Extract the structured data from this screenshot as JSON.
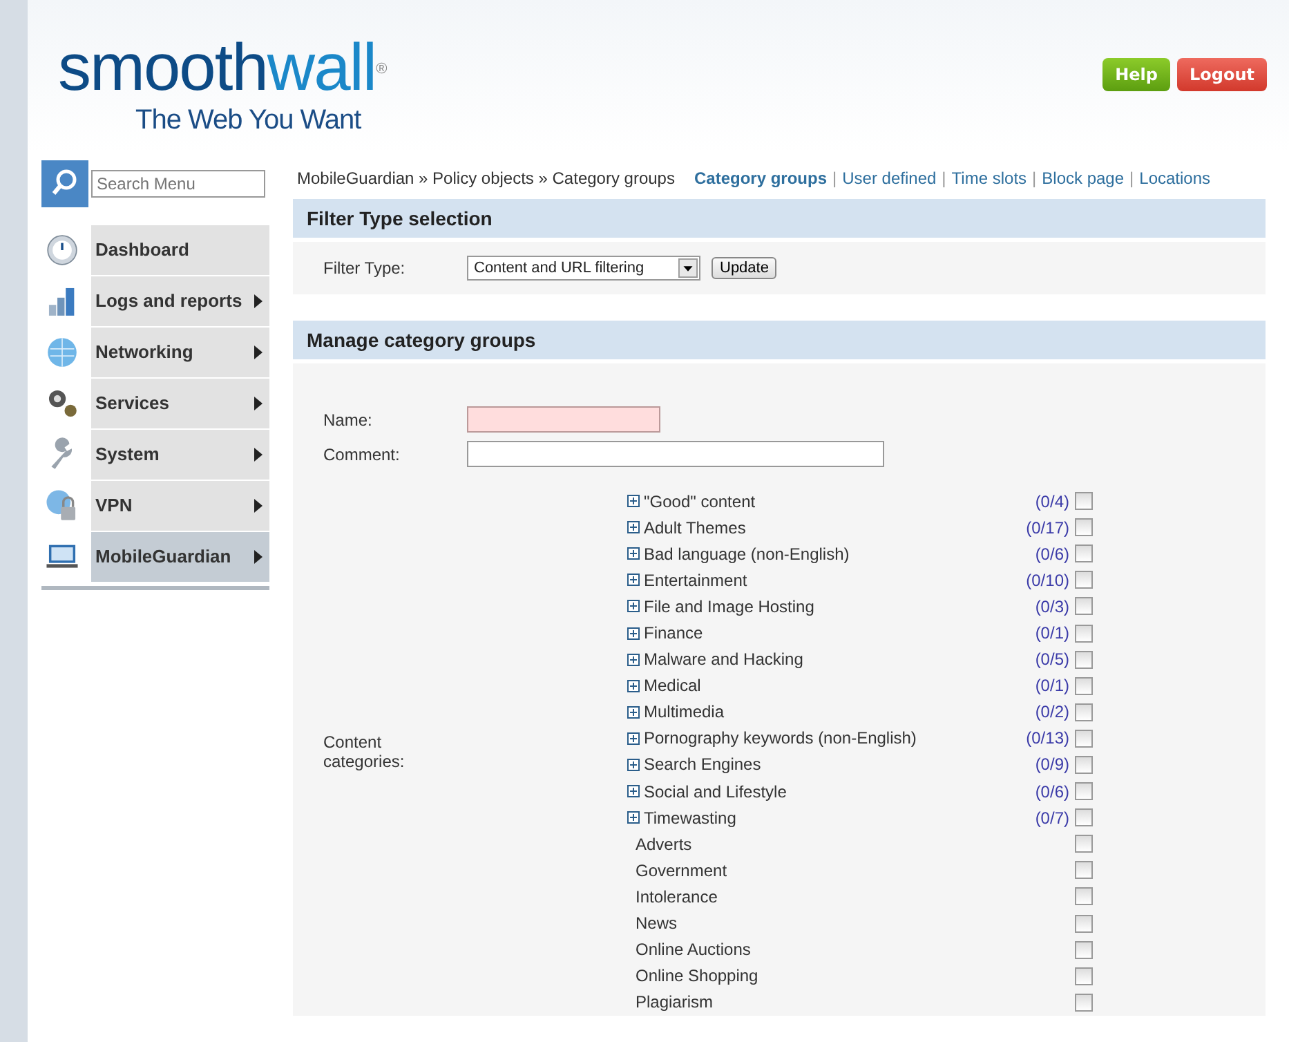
{
  "header": {
    "logo_main": "smooth",
    "logo_accent": "wall",
    "logo_mark": "®",
    "tagline": "The Web You Want",
    "buttons": [
      {
        "label": "Help",
        "kind": "help"
      },
      {
        "label": "Logout",
        "kind": "logout"
      }
    ]
  },
  "sidebar": {
    "search": {
      "placeholder": "Search Menu"
    },
    "items": [
      {
        "label": "Dashboard",
        "submenu": false,
        "selected": false
      },
      {
        "label": "Logs and reports",
        "submenu": true,
        "selected": false
      },
      {
        "label": "Networking",
        "submenu": true,
        "selected": false
      },
      {
        "label": "Services",
        "submenu": true,
        "selected": false
      },
      {
        "label": "System",
        "submenu": true,
        "selected": false
      },
      {
        "label": "VPN",
        "submenu": true,
        "selected": false
      },
      {
        "label": "MobileGuardian",
        "submenu": true,
        "selected": true
      }
    ]
  },
  "breadcrumb": "MobileGuardian » Policy objects » Category groups",
  "tab_separator": "|",
  "tabs": [
    {
      "label": "Category groups",
      "selected": true
    },
    {
      "label": "User defined",
      "selected": false
    },
    {
      "label": "Time slots",
      "selected": false
    },
    {
      "label": "Block page",
      "selected": false
    },
    {
      "label": "Locations",
      "selected": false
    }
  ],
  "filter_panel": {
    "title": "Filter Type selection",
    "label": "Filter Type:",
    "value": "Content and URL filtering",
    "button": "Update"
  },
  "manage_panel": {
    "title": "Manage category groups",
    "name_label": "Name:",
    "comment_label": "Comment:",
    "categories_label": "Content categories:",
    "categories": [
      {
        "kind": "group",
        "label": "\"Good\" content",
        "count": "(0/4)",
        "checked": false
      },
      {
        "kind": "group",
        "label": "Adult Themes",
        "count": "(0/17)",
        "checked": false
      },
      {
        "kind": "group",
        "label": "Bad language (non-English)",
        "count": "(0/6)",
        "checked": false
      },
      {
        "kind": "group",
        "label": "Entertainment",
        "count": "(0/10)",
        "checked": false
      },
      {
        "kind": "group",
        "label": "File and Image Hosting",
        "count": "(0/3)",
        "checked": false
      },
      {
        "kind": "group",
        "label": "Finance",
        "count": "(0/1)",
        "checked": false
      },
      {
        "kind": "group",
        "label": "Malware and Hacking",
        "count": "(0/5)",
        "checked": false
      },
      {
        "kind": "group",
        "label": "Medical",
        "count": "(0/1)",
        "checked": false
      },
      {
        "kind": "group",
        "label": "Multimedia",
        "count": "(0/2)",
        "checked": false
      },
      {
        "kind": "group",
        "label": "Pornography keywords (non-English)",
        "count": "(0/13)",
        "checked": false
      },
      {
        "kind": "group",
        "label": "Search Engines",
        "count": "(0/9)",
        "checked": false
      },
      {
        "kind": "group",
        "label": "Social and Lifestyle",
        "count": "(0/6)",
        "checked": false
      },
      {
        "kind": "group",
        "label": "Timewasting",
        "count": "(0/7)",
        "checked": false
      },
      {
        "kind": "item",
        "label": "Adverts",
        "checked": false
      },
      {
        "kind": "item",
        "label": "Government",
        "checked": false
      },
      {
        "kind": "item",
        "label": "Intolerance",
        "checked": false
      },
      {
        "kind": "item",
        "label": "News",
        "checked": false
      },
      {
        "kind": "item",
        "label": "Online Auctions",
        "checked": false
      },
      {
        "kind": "item",
        "label": "Online Shopping",
        "checked": false
      },
      {
        "kind": "item",
        "label": "Plagiarism",
        "checked": false
      }
    ]
  }
}
